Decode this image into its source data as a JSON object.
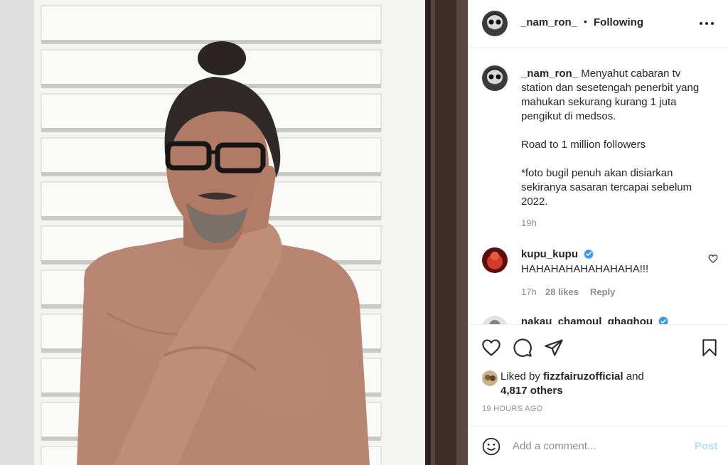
{
  "photo": {
    "alt_icon": "post-photo"
  },
  "header": {
    "username": "_nam_ron_",
    "separator": "•",
    "follow_state": "Following",
    "more_icon": "more-horizontal-icon"
  },
  "caption": {
    "username": "_nam_ron_",
    "text_line1": "Menyahut cabaran tv station dan sesetengah penerbit yang mahukan sekurang kurang 1 juta pengikut di medsos.",
    "text_line2": "Road to 1 million followers",
    "text_line3": "*foto bugil penuh akan disiarkan sekiranya sasaran tercapai sebelum 2022.",
    "time": "19h"
  },
  "comments": [
    {
      "username": "kupu_kupu",
      "verified": true,
      "text": "HAHAHAHAHAHAHAHA!!!",
      "time": "17h",
      "likes": "28 likes",
      "reply_label": "Reply"
    },
    {
      "username": "nakau_chamoul_ghaghou",
      "verified": true
    }
  ],
  "actions": {
    "like_icon": "heart-icon",
    "comment_icon": "comment-icon",
    "share_icon": "share-icon",
    "save_icon": "bookmark-icon"
  },
  "likes": {
    "prefix": "Liked by",
    "user": "fizzfairuzofficial",
    "conj": "and",
    "others": "4,817 others"
  },
  "posted": "19 HOURS AGO",
  "composer": {
    "placeholder": "Add a comment...",
    "post_label": "Post",
    "emoji_icon": "emoji-icon"
  },
  "colors": {
    "text": "#262626",
    "muted": "#8e8e8e",
    "post_disabled": "#b2dffc",
    "verified": "#3897f0",
    "divider": "#efefef"
  }
}
